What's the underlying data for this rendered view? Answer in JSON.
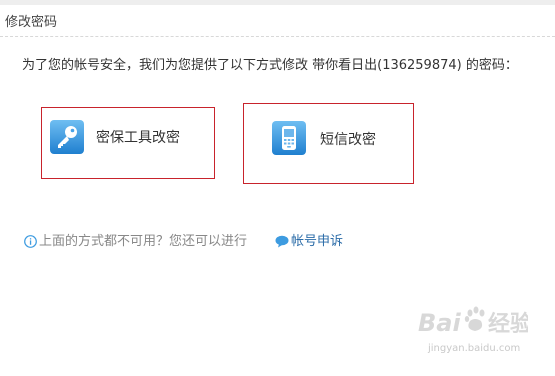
{
  "header": {
    "title": "修改密码"
  },
  "intro": {
    "text": "为了您的帐号安全，我们为您提供了以下方式修改 带你看日出(136259874) 的密码："
  },
  "options": [
    {
      "label": "密保工具改密",
      "icon": "key-icon"
    },
    {
      "label": "短信改密",
      "icon": "mobile-phone-icon"
    }
  ],
  "help": {
    "text": "上面的方式都不可用？您还可以进行",
    "link_label": "帐号申诉",
    "info_icon": "info-icon",
    "link_icon": "speech-bubble-icon"
  },
  "watermark": {
    "url": "jingyan.baidu.com"
  },
  "colors": {
    "option_border": "#c8232c",
    "link": "#2b6ca8",
    "icon_blue": "#3d9be0"
  }
}
